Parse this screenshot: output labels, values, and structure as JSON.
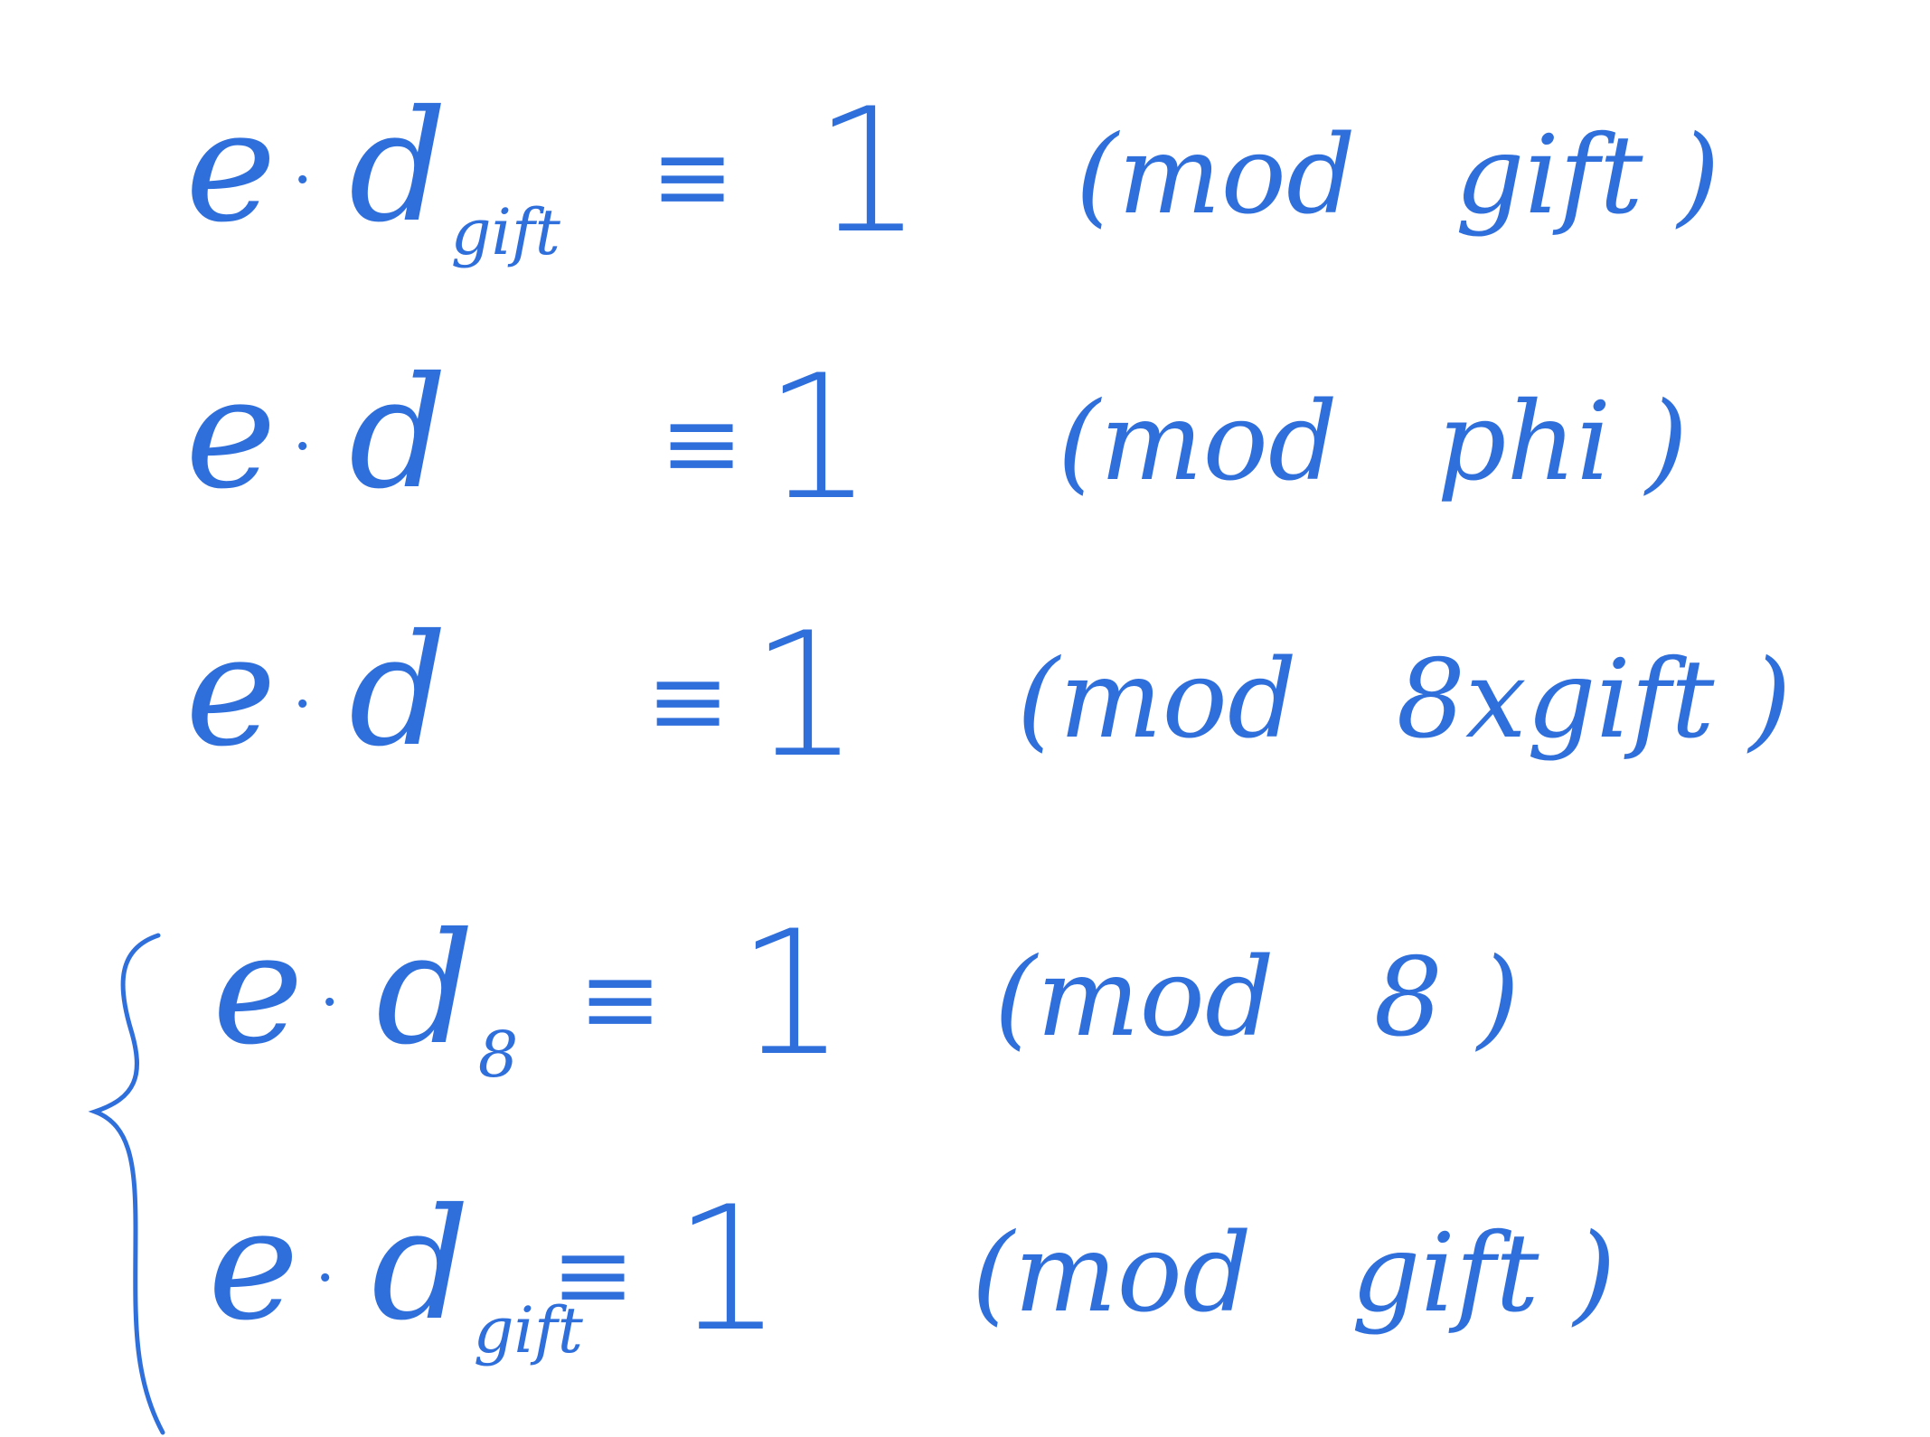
{
  "ink_color": "#2f6fdc",
  "background": "#ffffff",
  "equations": [
    {
      "lhs_base": "e",
      "dot": "·",
      "lhs_var": "d",
      "lhs_sub": "gift",
      "relation": "≡",
      "rhs": "1",
      "mod_word": "(mod",
      "modulus": "gift )"
    },
    {
      "lhs_base": "e",
      "dot": "·",
      "lhs_var": "d",
      "lhs_sub": "",
      "relation": "≡",
      "rhs": "1",
      "mod_word": "(mod",
      "modulus": "phi )"
    },
    {
      "lhs_base": "e",
      "dot": "·",
      "lhs_var": "d",
      "lhs_sub": "",
      "relation": "≡",
      "rhs": "1",
      "mod_word": "(mod",
      "modulus": "8xgift )"
    },
    {
      "lhs_base": "e",
      "dot": "·",
      "lhs_var": "d",
      "lhs_sub": "8",
      "relation": "≡",
      "rhs": "1",
      "mod_word": "(mod",
      "modulus": "8 )"
    },
    {
      "lhs_base": "e",
      "dot": "·",
      "lhs_var": "d",
      "lhs_sub": "gift",
      "relation": "≡",
      "rhs": "1",
      "mod_word": "(mod",
      "modulus": "gift )"
    }
  ],
  "brace_symbol": "{"
}
